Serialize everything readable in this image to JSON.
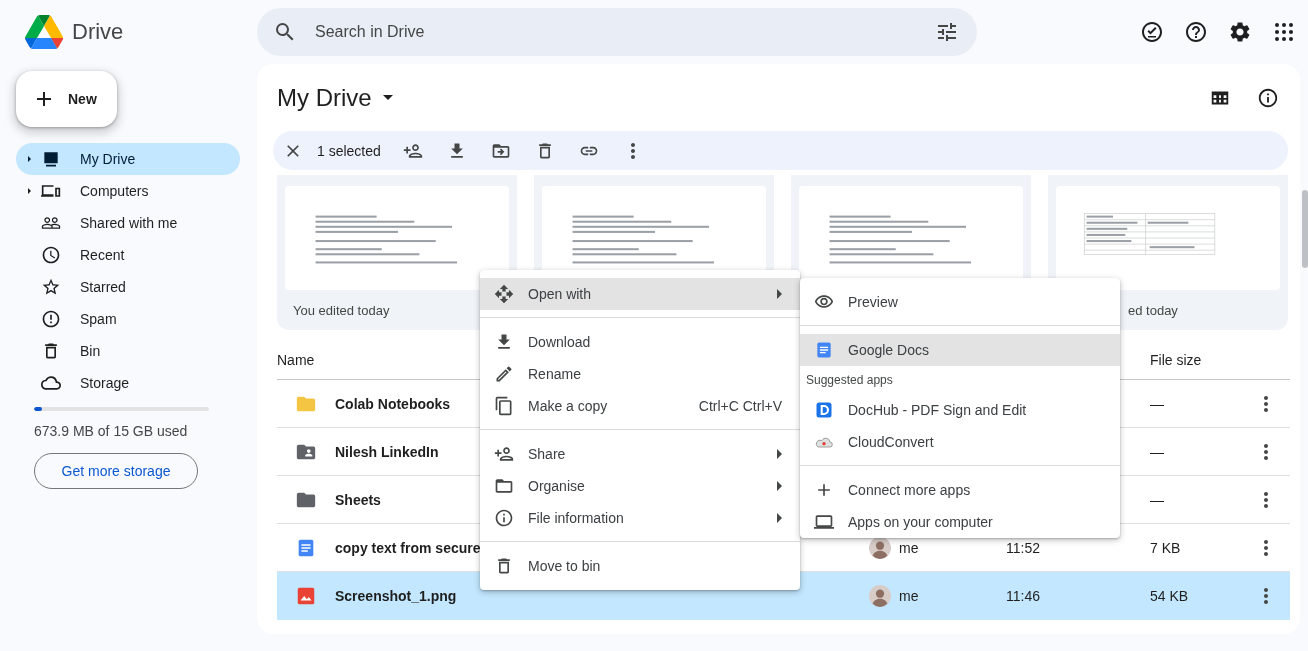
{
  "app": {
    "name": "Drive"
  },
  "search": {
    "placeholder": "Search in Drive"
  },
  "new_button": {
    "label": "New"
  },
  "sidebar": {
    "items": [
      {
        "label": "My Drive",
        "selected": true,
        "expandable": true
      },
      {
        "label": "Computers",
        "selected": false,
        "expandable": true
      },
      {
        "label": "Shared with me",
        "selected": false,
        "expandable": false
      },
      {
        "label": "Recent",
        "selected": false,
        "expandable": false
      },
      {
        "label": "Starred",
        "selected": false,
        "expandable": false
      },
      {
        "label": "Spam",
        "selected": false,
        "expandable": false
      },
      {
        "label": "Bin",
        "selected": false,
        "expandable": false
      },
      {
        "label": "Storage",
        "selected": false,
        "expandable": false
      }
    ]
  },
  "storage": {
    "level": 0.045,
    "text": "673.9 MB of 15 GB used",
    "button": "Get more storage"
  },
  "page_title": "My Drive",
  "selection_bar": {
    "count": "1 selected"
  },
  "cards": [
    {
      "kind": "doc",
      "caption": "You edited today"
    },
    {
      "kind": "doc"
    },
    {
      "kind": "doc"
    },
    {
      "kind": "sheet",
      "caption": "ed today"
    }
  ],
  "table": {
    "columns": [
      {
        "kind": "name",
        "label": "Name"
      },
      {
        "kind": "size",
        "label": "File size"
      }
    ],
    "rows": [
      {
        "kind": "folder",
        "name": "Colab Notebooks",
        "size": "—",
        "selected": false
      },
      {
        "kind": "shared-folder",
        "name": "Nilesh LinkedIn",
        "size": "—",
        "selected": false
      },
      {
        "kind": "folder-dark",
        "name": "Sheets",
        "size": "—",
        "selected": false
      },
      {
        "kind": "doc",
        "name": "copy text from secure",
        "owner": "me",
        "modified": "11:52",
        "size": "7 KB",
        "selected": false
      },
      {
        "kind": "image",
        "name": "Screenshot_1.png",
        "owner": "me",
        "modified": "11:46",
        "size": "54 KB",
        "selected": true
      }
    ]
  },
  "context_menu": {
    "items": [
      {
        "kind": "item",
        "label": "Open with",
        "submenu": true,
        "selected": true
      },
      {
        "kind": "divider"
      },
      {
        "kind": "item",
        "label": "Download",
        "selected": false
      },
      {
        "kind": "item",
        "label": "Rename",
        "selected": false
      },
      {
        "kind": "item",
        "label": "Make a copy",
        "shortcut": "Ctrl+C Ctrl+V",
        "selected": false
      },
      {
        "kind": "divider"
      },
      {
        "kind": "item",
        "label": "Share",
        "submenu": true,
        "selected": false
      },
      {
        "kind": "item",
        "label": "Organise",
        "submenu": true,
        "selected": false
      },
      {
        "kind": "item",
        "label": "File information",
        "submenu": true,
        "selected": false
      },
      {
        "kind": "divider"
      },
      {
        "kind": "item",
        "label": "Move to bin",
        "selected": false
      }
    ]
  },
  "open_with_menu": {
    "items": [
      {
        "kind": "item",
        "label": "Preview",
        "selected": false
      },
      {
        "kind": "divider"
      },
      {
        "kind": "item",
        "label": "Google Docs",
        "selected": true
      },
      {
        "kind": "heading",
        "label": "Suggested apps"
      },
      {
        "kind": "item",
        "label": "DocHub - PDF Sign and Edit",
        "selected": false
      },
      {
        "kind": "item",
        "label": "CloudConvert",
        "selected": false
      },
      {
        "kind": "divider"
      },
      {
        "kind": "item",
        "label": "Connect more apps",
        "selected": false
      },
      {
        "kind": "item",
        "label": "Apps on your computer",
        "selected": false
      }
    ]
  }
}
